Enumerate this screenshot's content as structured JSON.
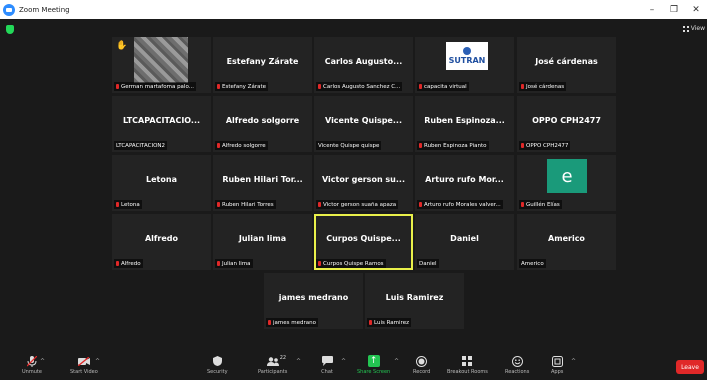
{
  "window": {
    "title": "Zoom Meeting",
    "minimize": "–",
    "maximize": "❐",
    "close": "✕"
  },
  "view_label": "View",
  "participants": [
    {
      "name": "",
      "label": "German  martafoma palo...",
      "muted": true,
      "special": "photo"
    },
    {
      "name": "Estefany Zárate",
      "label": "Estefany Zárate",
      "muted": true
    },
    {
      "name": "Carlos Augusto...",
      "label": "Carlos Augusto Sanchez C...",
      "muted": true
    },
    {
      "name": "",
      "label": "capacita virtual",
      "muted": true,
      "special": "logo",
      "logo_text": "SUTRAN"
    },
    {
      "name": "José cárdenas",
      "label": "José cárdenas",
      "muted": true
    },
    {
      "name": "LTCAPACITACIO...",
      "label": "LTCAPACITACION2",
      "muted": false
    },
    {
      "name": "Alfredo solgorre",
      "label": "Alfredo solgorre",
      "muted": true
    },
    {
      "name": "Vicente Quispe...",
      "label": "Vicente Quispe quispe",
      "muted": false
    },
    {
      "name": "Ruben Espinoza...",
      "label": "Ruben Espinoza Pianto",
      "muted": true
    },
    {
      "name": "OPPO CPH2477",
      "label": "OPPO CPH2477",
      "muted": true
    },
    {
      "name": "Letona",
      "label": "Letona",
      "muted": true
    },
    {
      "name": "Ruben Hilari Tor...",
      "label": "Ruben Hilari Torres",
      "muted": true
    },
    {
      "name": "Victor gerson su...",
      "label": "Victor gerson suaña apaza",
      "muted": true
    },
    {
      "name": "Arturo rufo Mor...",
      "label": "Arturo rufo Morales valver...",
      "muted": true
    },
    {
      "name": "",
      "label": "Guillén Elías",
      "muted": true,
      "special": "avatar",
      "avatar_letter": "e"
    },
    {
      "name": "Alfredo",
      "label": "Alfredo",
      "muted": true
    },
    {
      "name": "Julian lima",
      "label": "Julian lima",
      "muted": true
    },
    {
      "name": "Curpos Quispe...",
      "label": "Curpos Quispe Ramos",
      "muted": true,
      "active": true
    },
    {
      "name": "Daniel",
      "label": "Daniel",
      "muted": false
    },
    {
      "name": "Americo",
      "label": "Americo",
      "muted": false
    },
    {
      "name": "james medrano",
      "label": "james medrano",
      "muted": true
    },
    {
      "name": "Luis Ramirez",
      "label": "Luis Ramirez",
      "muted": true
    }
  ],
  "toolbar": {
    "unmute": "Unmute",
    "start_video": "Start Video",
    "security": "Security",
    "participants": "Participants",
    "participants_count": "22",
    "chat": "Chat",
    "share_screen": "Share Screen",
    "record": "Record",
    "breakout_rooms": "Breakout Rooms",
    "reactions": "Reactions",
    "apps": "Apps",
    "leave": "Leave"
  },
  "colors": {
    "leave": "#e02828",
    "share": "#23c552",
    "active_speaker": "#e9f04a",
    "muted_mic": "#e02828",
    "tile_bg": "#232323"
  }
}
